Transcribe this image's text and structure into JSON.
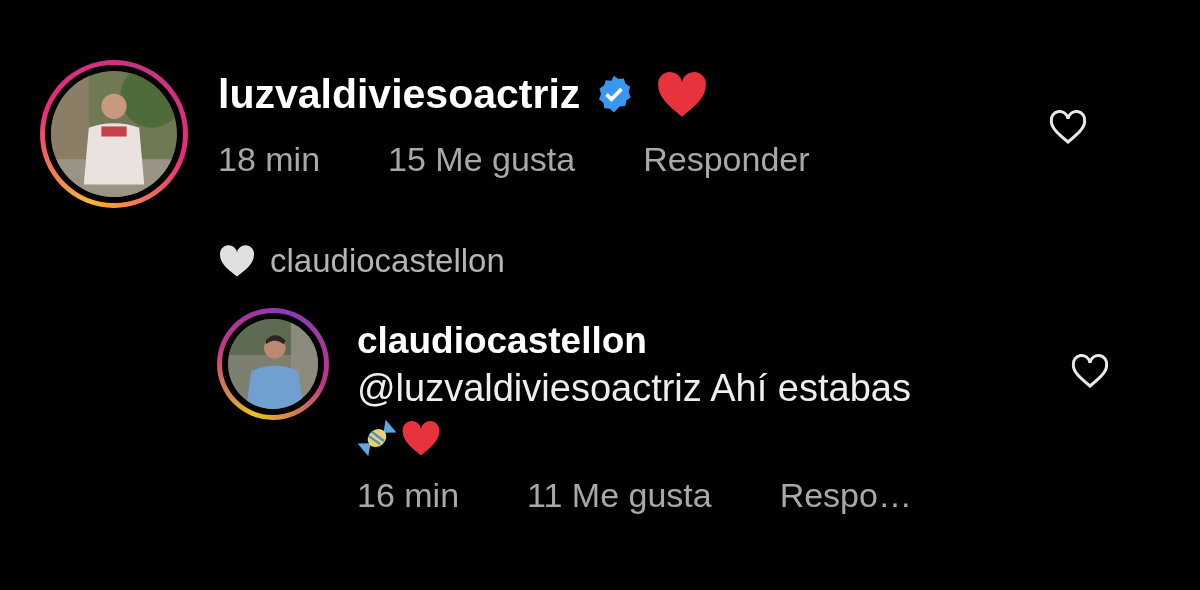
{
  "comment": {
    "username": "luzvaldiviesoactriz",
    "verified": true,
    "emojis": [
      {
        "kind": "heart"
      }
    ],
    "time": "18 min",
    "likes": "15 Me gusta",
    "reply_label": "Responder",
    "liked": false
  },
  "liked_by": {
    "username": "claudiocastellon"
  },
  "reply": {
    "username": "claudiocastellon",
    "verified": false,
    "text": "@luzvaldiviesoactriz Ahí estabas",
    "emojis": [
      {
        "kind": "candy"
      },
      {
        "kind": "heart"
      }
    ],
    "time": "16 min",
    "likes": "11 Me gusta",
    "reply_label": "Respo…",
    "liked": false
  }
}
